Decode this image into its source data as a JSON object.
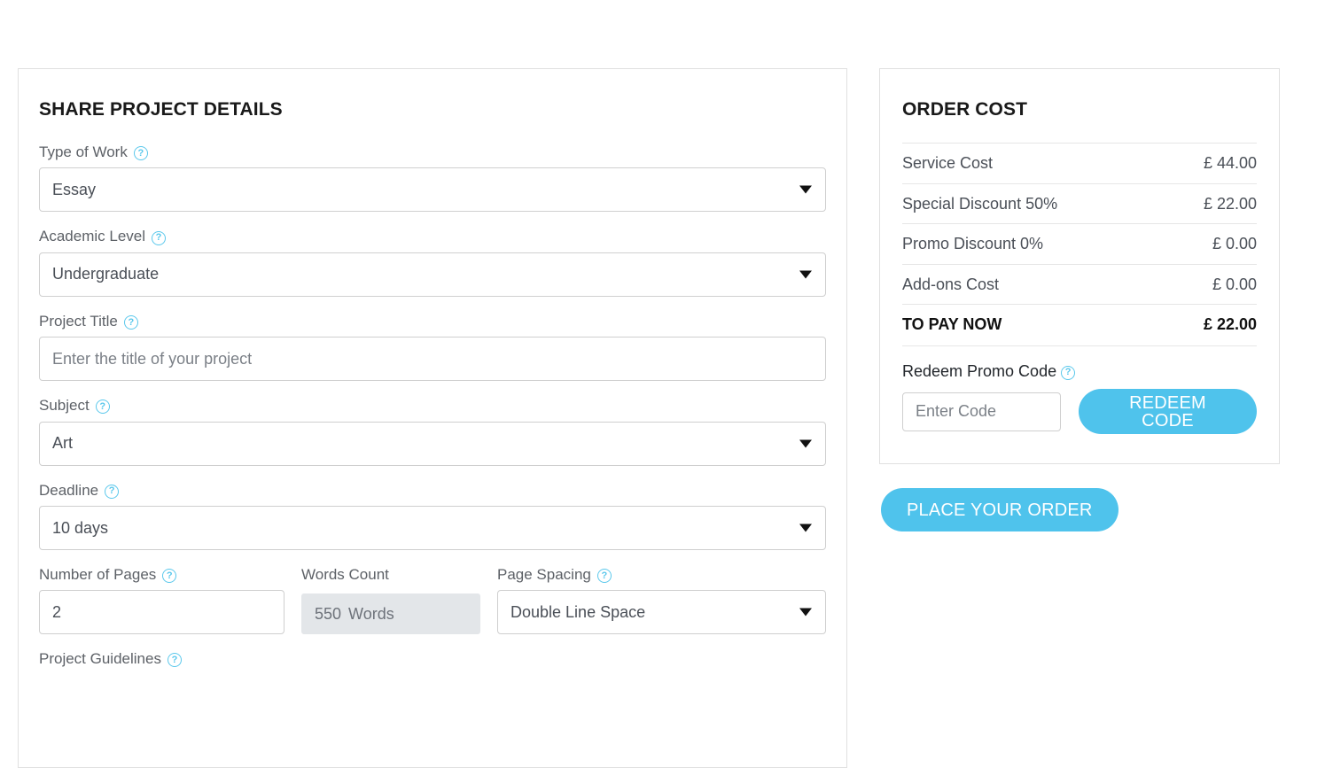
{
  "form": {
    "title": "SHARE PROJECT DETAILS",
    "help_glyph": "?",
    "fields": [
      {
        "label": "Type of Work",
        "value": "Essay",
        "type": "select"
      },
      {
        "label": "Academic Level",
        "value": "Undergraduate",
        "type": "select"
      },
      {
        "label": "Project Title",
        "value": "Enter the title of your project",
        "type": "text",
        "is_placeholder": true
      },
      {
        "label": "Subject",
        "value": "Art",
        "type": "select"
      },
      {
        "label": "Deadline",
        "value": "10 days",
        "type": "select"
      }
    ],
    "pages": {
      "label": "Number of Pages",
      "value": "2"
    },
    "words": {
      "label": "Words Count",
      "value": "550",
      "unit": "Words"
    },
    "spacing": {
      "label": "Page Spacing",
      "value": "Double Line Space"
    },
    "guidelines": {
      "label": "Project Guidelines"
    }
  },
  "order": {
    "title": "ORDER COST",
    "rows": [
      {
        "label": "Service Cost",
        "amount": "£ 44.00"
      },
      {
        "label": "Special Discount 50%",
        "amount": "£ 22.00"
      },
      {
        "label": "Promo Discount 0%",
        "amount": "£ 0.00"
      },
      {
        "label": "Add-ons Cost",
        "amount": "£ 0.00"
      }
    ],
    "total": {
      "label": "TO PAY NOW",
      "amount": "£ 22.00"
    },
    "promo": {
      "label": "Redeem Promo Code",
      "placeholder": "Enter Code",
      "button": "REDEEM CODE"
    },
    "place_order_button": "PLACE YOUR ORDER"
  },
  "colors": {
    "accent": "#4fc3ec",
    "help_icon": "#5bc8ec",
    "label": "#5d6167",
    "value": "#4a4f57",
    "border": "#cfcfcf",
    "card_border": "#e0e0e0",
    "disabled_bg": "#e3e6e9"
  }
}
